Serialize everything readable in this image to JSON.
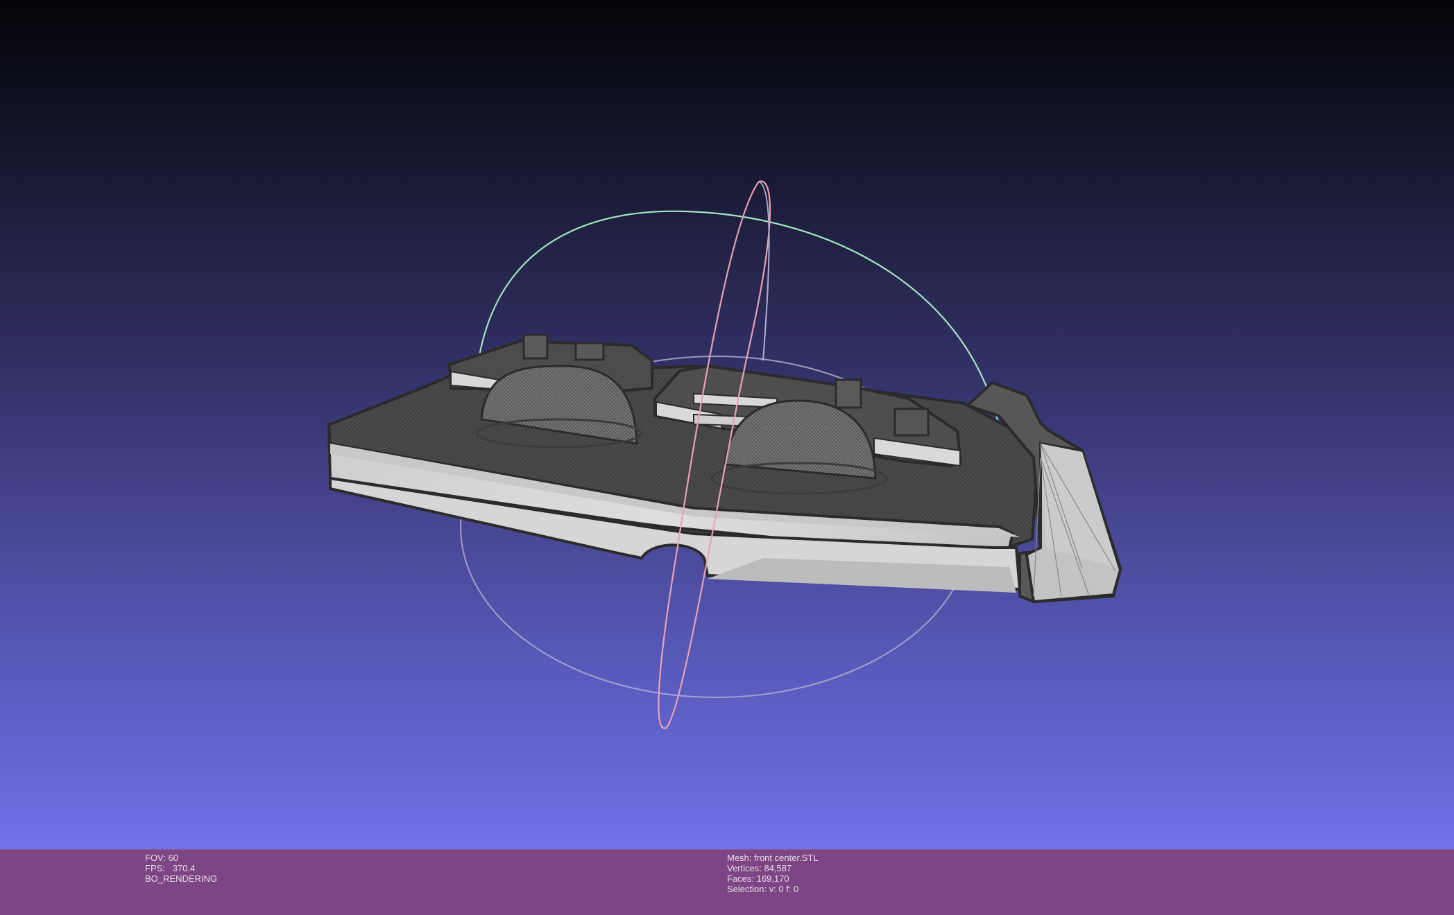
{
  "viewport": {
    "background_top": "#040408",
    "background_bottom": "#7474ec"
  },
  "gizmo": {
    "green_ring_color": "#a6e8c2",
    "pink_ring_color": "#e8a2b4",
    "gray_ring_color": "#b0aed0"
  },
  "mesh_colors": {
    "light_face": "#d4d4d4",
    "dark_face": "#474747",
    "wire": "#2e2e2e"
  },
  "info_bar": {
    "background": "#7d4584",
    "fov": "FOV: 60",
    "fps_label": "FPS:",
    "fps_value": "370.4",
    "rendering_mode": "BO_RENDERING",
    "mesh_name": "Mesh: front center.STL",
    "vertices": "Vertices: 84,587",
    "faces": "Faces: 169,170",
    "selection": "Selection: v: 0 f: 0"
  }
}
